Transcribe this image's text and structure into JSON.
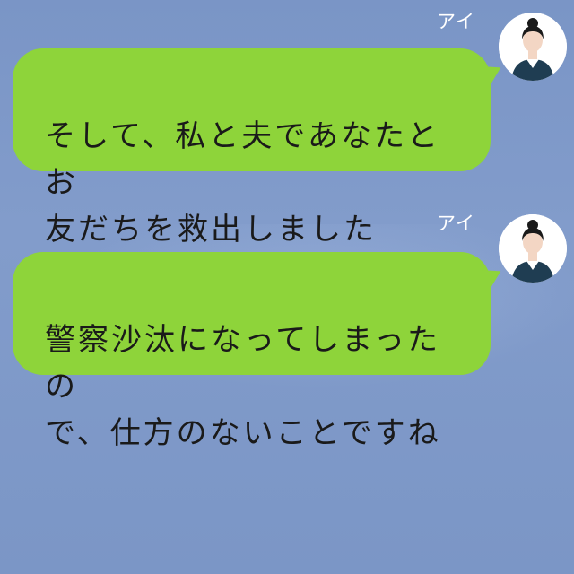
{
  "chat": {
    "messages": [
      {
        "sender": "アイ",
        "text": "そして、私と夫であなたとお\n友だちを救出しました",
        "avatar_icon": "woman-avatar-icon"
      },
      {
        "sender": "アイ",
        "text": "警察沙汰になってしまったの\nで、仕方のないことですね",
        "avatar_icon": "woman-avatar-icon"
      }
    ]
  },
  "colors": {
    "background": "#7d97c6",
    "bubble": "#8ed43a",
    "name_text": "#ffffff",
    "message_text": "#1a1a1a"
  }
}
